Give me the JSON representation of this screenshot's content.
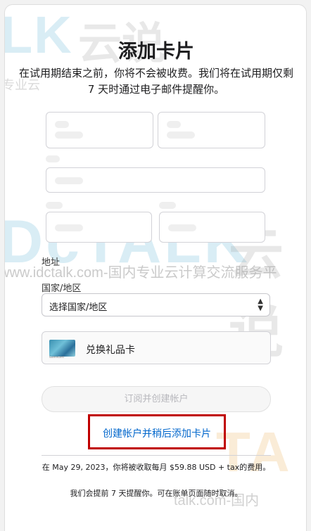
{
  "watermark": {
    "logo_text": "LK",
    "logo_cn": "云说",
    "tagline": "专业云",
    "logo_mid": "DcTALK",
    "logo_mid_cn": "云说",
    "url_line": "www.idctalk.com-国内专业云计算交流服务平",
    "logo_bot": "TA",
    "url_bot": "talk.com-国内"
  },
  "page": {
    "title": "添加卡片",
    "subtitle": "在试用期结束之前，你将不会被收费。我们将在试用期仅剩 7 天时通过电子邮件提醒你。"
  },
  "address": {
    "section_label": "地址",
    "country_label": "国家/地区",
    "country_select_value": "选择国家/地区"
  },
  "gift_card": {
    "label": "兑换礼品卡",
    "thumbnail_text": "Gamecard"
  },
  "actions": {
    "subscribe_label": "订阅并创建帐户",
    "create_later_label": "创建帐户并稍后添加卡片"
  },
  "colors": {
    "accent_link": "#0066cc",
    "highlight_border": "#c00000",
    "disabled_text": "#b8b8bd"
  },
  "footer": {
    "charge_notice": "在 May 29, 2023，你将被收取每月 $59.88 USD + tax的费用。",
    "reminder_notice": "我们会提前 7 天提醒你。可在账单页面随时取消。"
  }
}
